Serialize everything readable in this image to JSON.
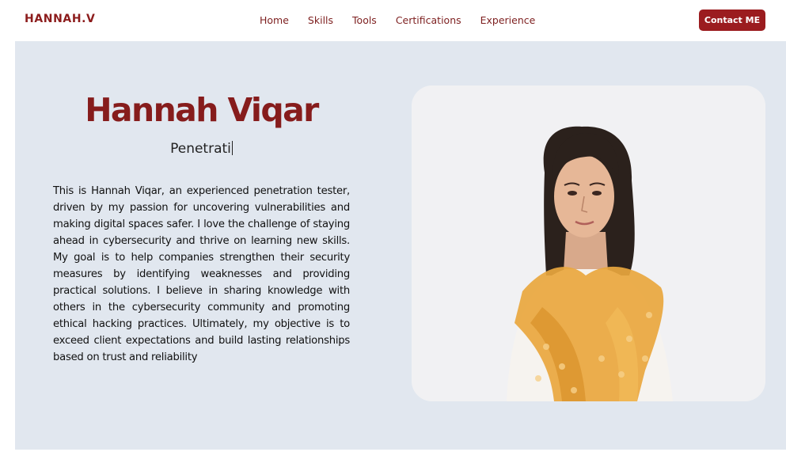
{
  "nav": {
    "brand": "HANNAH.V",
    "links": [
      "Home",
      "Skills",
      "Tools",
      "Certifications",
      "Experience"
    ],
    "contact_label": "Contact ME"
  },
  "hero": {
    "name": "Hannah Viqar",
    "typed_text": "Penetrati",
    "bio": "This is Hannah Viqar, an experienced penetration tester, driven by my passion for uncovering vulnerabilities and making digital spaces safer. I love the challenge of staying ahead in cybersecurity and thrive on learning new skills. My goal is to help companies strengthen their security measures by identifying weaknesses and providing practical solutions. I believe in sharing knowledge with others in the cybersecurity community and promoting ethical hacking practices. Ultimately, my objective is to exceed client expectations and build lasting relationships based on trust and reliability",
    "photo_icon": "portrait-photo"
  },
  "colors": {
    "brand": "#8c1c1c",
    "button": "#9b1c1f",
    "hero_bg": "#e1e7ef",
    "scarf": "#e9a73e"
  }
}
